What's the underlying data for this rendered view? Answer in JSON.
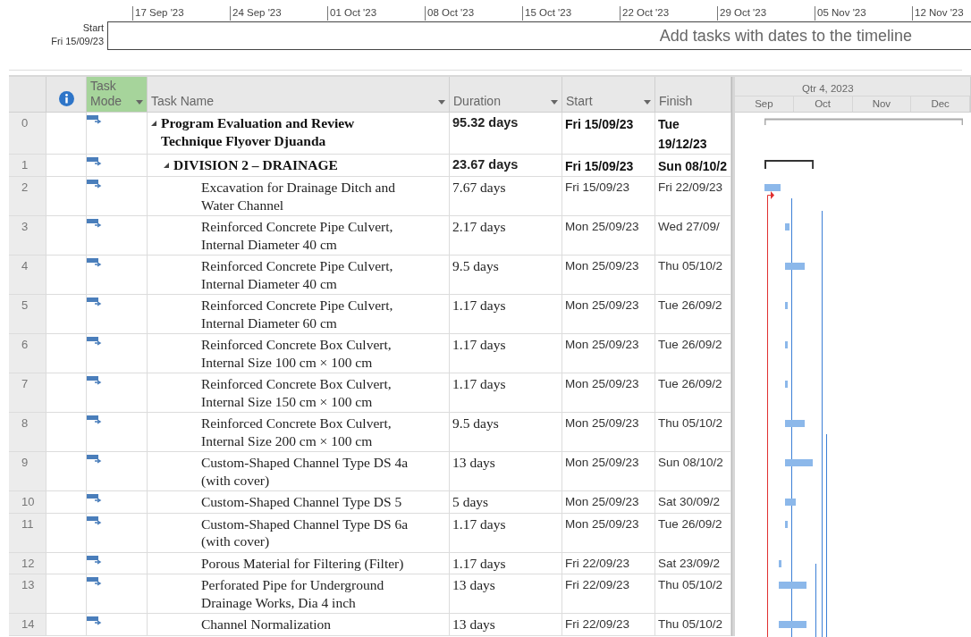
{
  "timeline": {
    "ticks": [
      "17 Sep '23",
      "24 Sep '23",
      "01 Oct '23",
      "08 Oct '23",
      "15 Oct '23",
      "22 Oct '23",
      "29 Oct '23",
      "05 Nov '23",
      "12 Nov '23"
    ],
    "start_label": "Start",
    "start_date": "Fri 15/09/23",
    "message": "Add tasks with dates to the timeline"
  },
  "columns": [
    {
      "kind": "info",
      "dropdown": false,
      "selected": false
    },
    {
      "kind": "text",
      "label": "Task Mode",
      "dropdown": true,
      "selected": true
    },
    {
      "kind": "text",
      "label": "Task Name",
      "dropdown": true,
      "selected": false
    },
    {
      "kind": "text",
      "label": "Duration",
      "dropdown": true,
      "selected": false
    },
    {
      "kind": "text",
      "label": "Start",
      "dropdown": true,
      "selected": false
    },
    {
      "kind": "text",
      "label": "Finish",
      "dropdown": false,
      "selected": false
    }
  ],
  "gantt_header": {
    "quarter": "Qtr 4, 2023",
    "months": [
      "Sep",
      "Oct",
      "Nov",
      "Dec"
    ]
  },
  "tasks": [
    {
      "id": "0",
      "name": "Program Evaluation and Review Technique Flyover Djuanda",
      "duration": "95.32 days",
      "start": "Fri 15/09/23",
      "finish": "Tue 19/12/23",
      "expanded": true,
      "children": [
        {
          "id": "1",
          "name": "DIVISION 2 – DRAINAGE",
          "duration": "23.67 days",
          "start": "Fri 15/09/23",
          "finish": "Sun 08/10/2",
          "expanded": true,
          "children": [
            {
              "id": "2",
              "name": "Excavation for Drainage Ditch and Water Channel",
              "duration": "7.67 days",
              "start": "Fri 15/09/23",
              "finish": "Fri 22/09/23"
            },
            {
              "id": "3",
              "name": "Reinforced Concrete Pipe Culvert, Internal Diameter 40 cm",
              "duration": "2.17 days",
              "start": "Mon 25/09/23",
              "finish": "Wed 27/09/"
            },
            {
              "id": "4",
              "name": "Reinforced Concrete Pipe Culvert, Internal Diameter 40 cm",
              "duration": "9.5 days",
              "start": "Mon 25/09/23",
              "finish": "Thu 05/10/2"
            },
            {
              "id": "5",
              "name": "Reinforced Concrete Pipe Culvert, Internal Diameter 60 cm",
              "duration": "1.17 days",
              "start": "Mon 25/09/23",
              "finish": "Tue 26/09/2"
            },
            {
              "id": "6",
              "name": "Reinforced Concrete Box Culvert, Internal Size 100 cm × 100 cm",
              "duration": "1.17 days",
              "start": "Mon 25/09/23",
              "finish": "Tue 26/09/2"
            },
            {
              "id": "7",
              "name": "Reinforced Concrete Box Culvert, Internal Size 150 cm × 100 cm",
              "duration": "1.17 days",
              "start": "Mon 25/09/23",
              "finish": "Tue 26/09/2"
            },
            {
              "id": "8",
              "name": "Reinforced Concrete Box Culvert, Internal Size 200 cm × 100 cm",
              "duration": "9.5 days",
              "start": "Mon 25/09/23",
              "finish": "Thu 05/10/2"
            },
            {
              "id": "9",
              "name": "Custom-Shaped Channel Type DS 4a (with cover)",
              "duration": "13 days",
              "start": "Mon 25/09/23",
              "finish": "Sun 08/10/2"
            },
            {
              "id": "10",
              "name": "Custom-Shaped Channel Type DS 5",
              "duration": "5 days",
              "start": "Mon 25/09/23",
              "finish": "Sat 30/09/2"
            },
            {
              "id": "11",
              "name": "Custom-Shaped Channel Type DS 6a (with cover)",
              "duration": "1.17 days",
              "start": "Mon 25/09/23",
              "finish": "Tue 26/09/2"
            },
            {
              "id": "12",
              "name": "Porous Material for Filtering (Filter)",
              "duration": "1.17 days",
              "start": "Fri 22/09/23",
              "finish": "Sat 23/09/2"
            },
            {
              "id": "13",
              "name": "Perforated Pipe for Underground Drainage Works, Dia 4 inch",
              "duration": "13 days",
              "start": "Fri 22/09/23",
              "finish": "Thu 05/10/2"
            },
            {
              "id": "14",
              "name": "Channel Normalization",
              "duration": "13 days",
              "start": "Fri 22/09/23",
              "finish": "Thu 05/10/2"
            }
          ]
        }
      ]
    }
  ]
}
